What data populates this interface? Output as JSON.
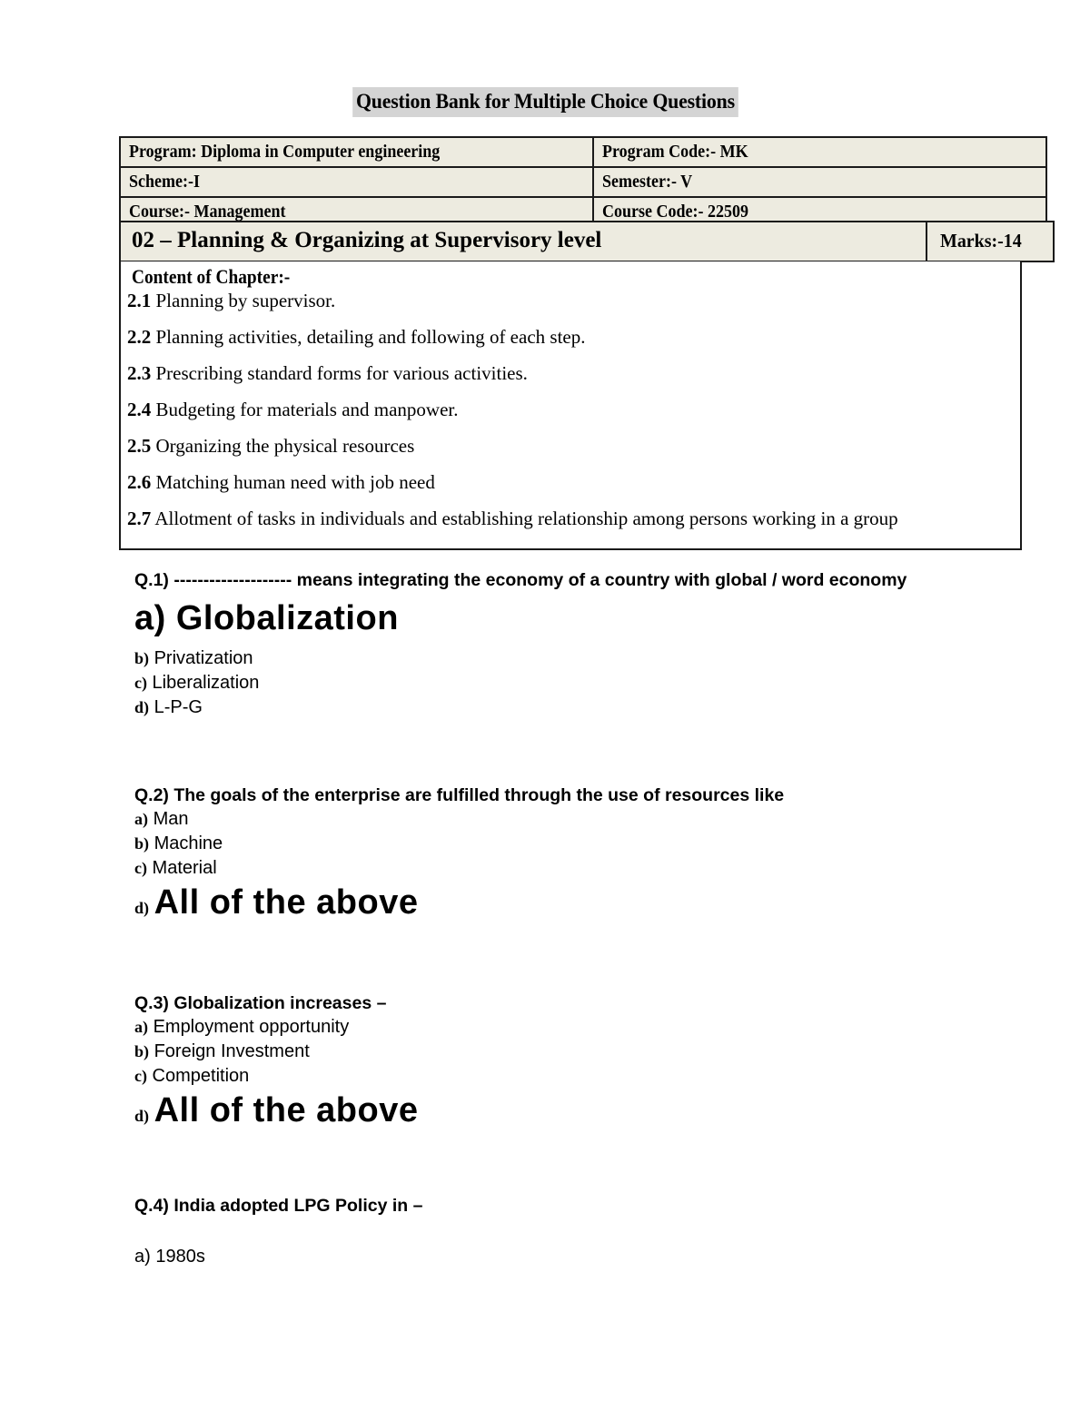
{
  "document": {
    "title": "Question Bank for Multiple Choice Questions"
  },
  "info_table": {
    "rows": [
      {
        "left": "Program: Diploma in Computer engineering",
        "right": "Program Code:- MK"
      },
      {
        "left": "Scheme:-I",
        "right": "Semester:- V"
      },
      {
        "left": "Course:- Management",
        "right": "Course Code:- 22509"
      }
    ]
  },
  "chapter": {
    "title": "02 – Planning & Organizing at Supervisory level",
    "marks": "Marks:-14",
    "content_heading": "Content of Chapter:-",
    "items": [
      {
        "num": "2.1",
        "text": "Planning by supervisor."
      },
      {
        "num": "2.2",
        "text": "Planning activities, detailing and following of each step."
      },
      {
        "num": "2.3",
        "text": "Prescribing standard forms for various activities."
      },
      {
        "num": "2.4",
        "text": " Budgeting for materials and manpower."
      },
      {
        "num": "2.5",
        "text": "Organizing the physical resources"
      },
      {
        "num": "2.6",
        "text": "Matching human need with job need"
      },
      {
        "num": "2.7",
        "text": "Allotment of tasks in individuals and establishing relationship among persons working in a group"
      }
    ]
  },
  "questions": [
    {
      "id": "q1",
      "text": "Q.1) -------------------- means integrating the economy of a country with global / word economy",
      "options": [
        {
          "label": "a)",
          "text": "Globalization"
        },
        {
          "label": "b)",
          "text": "Privatization"
        },
        {
          "label": "c)",
          "text": "Liberalization"
        },
        {
          "label": "d)",
          "text": "L-P-G"
        }
      ]
    },
    {
      "id": "q2",
      "text": "Q.2) The goals of the enterprise are fulfilled through the use of resources like",
      "options": [
        {
          "label": "a)",
          "text": "Man"
        },
        {
          "label": "b)",
          "text": "Machine"
        },
        {
          "label": "c)",
          "text": "Material"
        },
        {
          "label": "d)",
          "text": "All of the above"
        }
      ]
    },
    {
      "id": "q3",
      "text": "Q.3) Globalization increases –",
      "options": [
        {
          "label": "a)",
          "text": "Employment opportunity"
        },
        {
          "label": "b)",
          "text": "Foreign Investment"
        },
        {
          "label": "c)",
          "text": "Competition"
        },
        {
          "label": "d)",
          "text": "All of the above"
        }
      ]
    },
    {
      "id": "q4",
      "text": "Q.4) India adopted LPG Policy in –",
      "options": [
        {
          "label": "a)",
          "text": "1980s"
        }
      ]
    }
  ],
  "colors": {
    "title_highlight": "#d4d4d4",
    "table_cell_bg": "#edebe0",
    "border": "#1a1a1a",
    "page_bg": "#ffffff",
    "text": "#000000"
  }
}
